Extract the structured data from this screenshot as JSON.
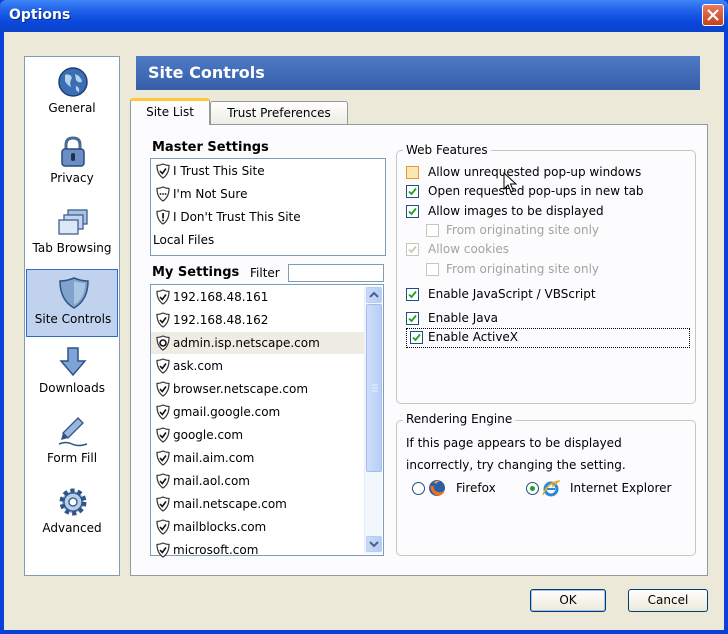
{
  "window": {
    "title": "Options"
  },
  "sidebar": {
    "items": [
      {
        "label": "General",
        "icon": "globe-icon"
      },
      {
        "label": "Privacy",
        "icon": "lock-icon"
      },
      {
        "label": "Tab Browsing",
        "icon": "tabs-icon"
      },
      {
        "label": "Site Controls",
        "icon": "shield-icon",
        "selected": true
      },
      {
        "label": "Downloads",
        "icon": "download-arrow-icon"
      },
      {
        "label": "Form Fill",
        "icon": "pen-icon"
      },
      {
        "label": "Advanced",
        "icon": "gear-icon"
      }
    ]
  },
  "header": {
    "title": "Site Controls"
  },
  "tabs": [
    {
      "label": "Site List",
      "active": true
    },
    {
      "label": "Trust Preferences",
      "active": false
    }
  ],
  "master": {
    "title": "Master Settings",
    "items": [
      "I Trust This Site",
      "I'm Not Sure",
      "I Don't Trust This Site",
      "Local Files"
    ]
  },
  "my_settings": {
    "title": "My Settings",
    "filter_label": "Filter",
    "filter_value": "",
    "sites": [
      "192.168.48.161",
      "192.168.48.162",
      "admin.isp.netscape.com",
      "ask.com",
      "browser.netscape.com",
      "gmail.google.com",
      "google.com",
      "mail.aim.com",
      "mail.aol.com",
      "mail.netscape.com",
      "mailblocks.com",
      "microsoft.com"
    ],
    "selected_site": "admin.isp.netscape.com"
  },
  "web_features": {
    "title": "Web Features",
    "items": [
      {
        "label": "Allow unrequested pop-up windows",
        "checked": false,
        "disabled": false
      },
      {
        "label": "Open requested pop-ups in new tab",
        "checked": true,
        "disabled": false
      },
      {
        "label": "Allow images to be displayed",
        "checked": true,
        "disabled": false
      },
      {
        "label": "From originating site only",
        "checked": false,
        "disabled": true
      },
      {
        "label": "Allow cookies",
        "checked": true,
        "disabled": true
      },
      {
        "label": "From originating site only",
        "checked": false,
        "disabled": true
      },
      {
        "label": "Enable JavaScript / VBScript",
        "checked": true,
        "disabled": false
      },
      {
        "label": "Enable Java",
        "checked": true,
        "disabled": false
      },
      {
        "label": "Enable ActiveX",
        "checked": true,
        "disabled": false
      }
    ]
  },
  "rendering": {
    "title": "Rendering Engine",
    "description_line1": "If this page appears to be displayed",
    "description_line2": "incorrectly, try changing the setting.",
    "options": [
      {
        "label": "Firefox",
        "selected": false,
        "icon": "firefox-icon"
      },
      {
        "label": "Internet Explorer",
        "selected": true,
        "icon": "internet-explorer-icon"
      }
    ]
  },
  "buttons": {
    "ok": "OK",
    "cancel": "Cancel"
  },
  "colors": {
    "titlebar": "#0a48dc",
    "header": "#4470c0",
    "selection": "#c1d2ee",
    "dialog_bg": "#ece9d8"
  }
}
